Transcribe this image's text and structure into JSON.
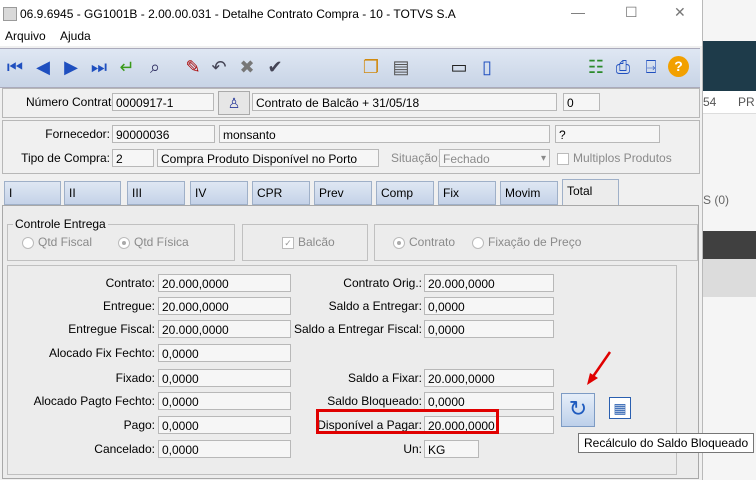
{
  "window": {
    "title": "06.9.6945 - GG1001B - 2.00.00.031 - Detalhe Contrato Compra - 10 - TOTVS S.A"
  },
  "menu": {
    "arquivo": "Arquivo",
    "ajuda": "Ajuda"
  },
  "window_controls": {
    "minimize": "—",
    "maximize": "☐",
    "close": "✕"
  },
  "header": {
    "numero_label": "Número Contrato:",
    "numero_value": "0000917-1",
    "descricao_value": "Contrato de Balcão + 31/05/18",
    "extra_value": "0",
    "fornecedor_label": "Fornecedor:",
    "fornecedor_code": "90000036",
    "fornecedor_name": "monsanto",
    "fornecedor_extra": "?",
    "tipo_label": "Tipo de Compra:",
    "tipo_code": "2",
    "tipo_desc": "Compra Produto Disponível no Porto",
    "situacao_label": "Situação:",
    "situacao_value": "Fechado",
    "multiplos_label": "Multiplos Produtos"
  },
  "tabs": [
    "I",
    "II",
    "III",
    "IV",
    "CPR",
    "Prev",
    "Comp",
    "Fix",
    "Movim",
    "Total"
  ],
  "controle": {
    "title": "Controle Entrega",
    "qtd_fiscal": "Qtd Fiscal",
    "qtd_fisica": "Qtd Física",
    "balcao": "Balcão",
    "contrato": "Contrato",
    "fixacao": "Fixação de Preço"
  },
  "totals_left": [
    {
      "label": "Contrato:",
      "value": "20.000,0000"
    },
    {
      "label": "Entregue:",
      "value": "20.000,0000"
    },
    {
      "label": "Entregue Fiscal:",
      "value": "20.000,0000"
    },
    {
      "label": "Alocado Fix Fechto:",
      "value": "0,0000"
    },
    {
      "label": "Fixado:",
      "value": "0,0000"
    },
    {
      "label": "Alocado Pagto Fechto:",
      "value": "0,0000"
    },
    {
      "label": "Pago:",
      "value": "0,0000"
    },
    {
      "label": "Cancelado:",
      "value": "0,0000"
    }
  ],
  "totals_right": [
    {
      "label": "Contrato Orig.:",
      "value": "20.000,0000"
    },
    {
      "label": "Saldo a Entregar:",
      "value": "0,0000"
    },
    {
      "label": "Saldo a Entregar Fiscal:",
      "value": "0,0000"
    },
    {
      "label": "Saldo a Fixar:",
      "value": "20.000,0000"
    },
    {
      "label": "Saldo Bloqueado:",
      "value": "0,0000"
    },
    {
      "label": "Disponível a Pagar:",
      "value": "20.000,0000"
    },
    {
      "label": "Un:",
      "value": "KG"
    }
  ],
  "tooltip": "Recálculo do Saldo Bloqueado",
  "background_app": {
    "tab1": "54",
    "tab2": "PR",
    "count": "S  (0)"
  },
  "colors": {
    "highlight_red": "#e00000",
    "toolbar_blue": "#1f4fbf",
    "dark_bar": "#1e3b4a"
  }
}
